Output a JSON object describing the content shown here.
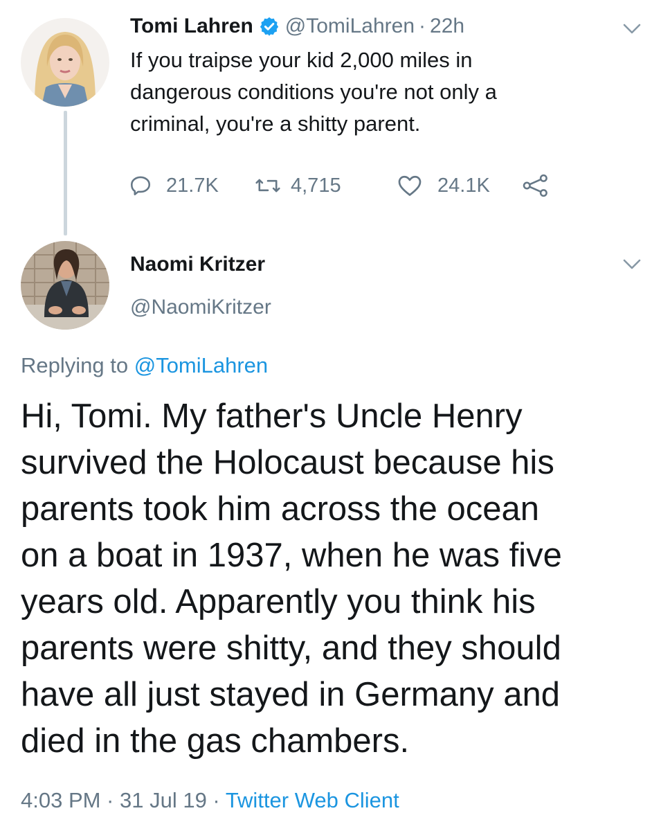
{
  "tweet": {
    "author_name": "Tomi Lahren",
    "handle": "@TomiLahren",
    "separator": "·",
    "time": "22h",
    "text_lines": [
      "If you traipse your kid 2,000 miles in",
      "dangerous conditions you're not only a",
      "criminal, you're a shitty parent."
    ],
    "stats": {
      "replies": "21.7K",
      "retweets": "4,715",
      "likes": "24.1K"
    },
    "icons": [
      "verified-badge-icon",
      "reply-icon",
      "retweet-icon",
      "like-icon",
      "share-icon",
      "chevron-down-icon"
    ]
  },
  "reply": {
    "author_name": "Naomi Kritzer",
    "handle": "@NaomiKritzer",
    "replying_prefix": "Replying to",
    "replying_mention": "@TomiLahren",
    "text_lines": [
      "Hi, Tomi. My father's Uncle Henry",
      "survived the Holocaust because his",
      "parents took him across the ocean",
      "on a boat in 1937, when he was five",
      "years old. Apparently you think his",
      "parents were shitty, and they should",
      "have all just stayed in Germany and",
      "died in the gas chambers."
    ],
    "timestamp": "4:03 PM · 31 Jul 19 ·",
    "client": "Twitter Web Client"
  },
  "colors": {
    "text": "#14171a",
    "secondary": "#657786",
    "link": "#1b95e0",
    "verified": "#1da1f2",
    "thread_line": "#ccd6dd"
  }
}
